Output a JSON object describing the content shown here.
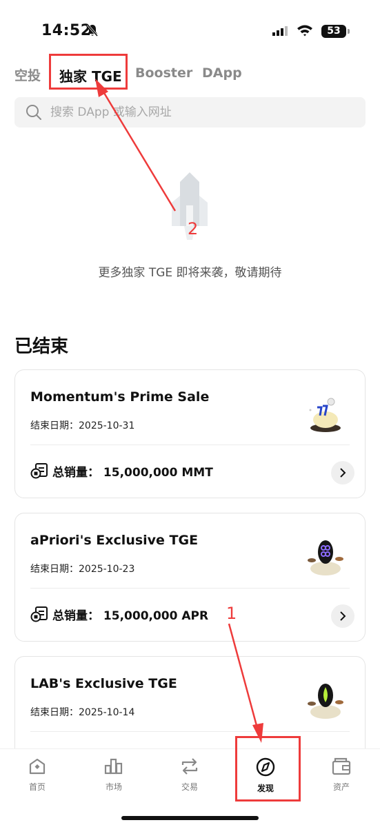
{
  "status_bar": {
    "time": "14:52",
    "battery": "53"
  },
  "tabs": [
    {
      "label": "空投"
    },
    {
      "label": "独家 TGE"
    },
    {
      "label": "Booster"
    },
    {
      "label": "DApp"
    }
  ],
  "search": {
    "placeholder": "搜索 DApp 或输入网址",
    "value": ""
  },
  "empty_state": {
    "text": "更多独家 TGE 即将来袭，敬请期待"
  },
  "section": {
    "title": "已结束"
  },
  "cards": [
    {
      "title": "Momentum's Prime Sale",
      "date": "结束日期：2025-10-31",
      "sales": "总销量：  15,000,000 MMT"
    },
    {
      "title": "aPriori's Exclusive TGE",
      "date": "结束日期：2025-10-23",
      "sales": "总销量：  15,000,000 APR"
    },
    {
      "title": "LAB's Exclusive TGE",
      "date": "结束日期：2025-10-14",
      "sales": ""
    }
  ],
  "nav": [
    {
      "label": "首页",
      "icon": "home-icon"
    },
    {
      "label": "市场",
      "icon": "market-chart-icon"
    },
    {
      "label": "交易",
      "icon": "trade-swap-icon"
    },
    {
      "label": "发现",
      "icon": "compass-icon",
      "active": true
    },
    {
      "label": "资产",
      "icon": "wallet-icon"
    }
  ],
  "annotations": {
    "marker_1": "1",
    "marker_2": "2"
  },
  "colors": {
    "annotation": "#ee3b3b",
    "text": "#111111",
    "muted": "#8a8a8a"
  }
}
